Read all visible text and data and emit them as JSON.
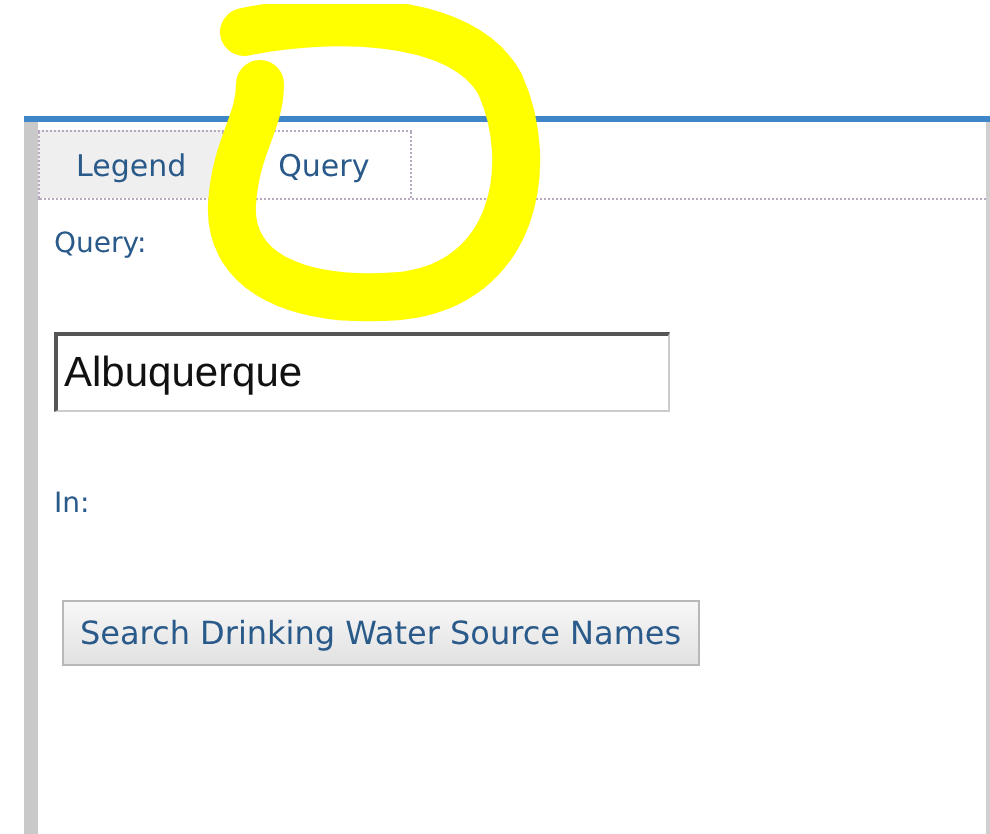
{
  "tabs": [
    {
      "label": "Legend",
      "selected": false
    },
    {
      "label": "Query",
      "selected": true
    }
  ],
  "query_label": "Query:",
  "query_field": {
    "value": "Albuquerque"
  },
  "in_label": "In:",
  "search_button": "Search Drinking Water Source Names"
}
